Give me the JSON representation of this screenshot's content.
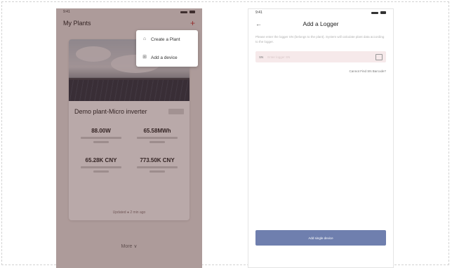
{
  "phone1": {
    "status_time": "9:41",
    "nav_title": "My Plants",
    "nav_action": "+",
    "plant": {
      "name": "Demo plant-Micro inverter",
      "stats": [
        {
          "value": "88.00W"
        },
        {
          "value": "65.58MWh"
        },
        {
          "value": "65.28K CNY"
        },
        {
          "value": "773.50K CNY"
        }
      ],
      "footer": "Updated ● 2 min ago"
    },
    "more": "More ∨"
  },
  "popup": {
    "items": [
      {
        "icon": "create-plant-icon",
        "label": "Create a Plant"
      },
      {
        "icon": "add-device-icon",
        "label": "Add a device"
      }
    ]
  },
  "phone2": {
    "status_time": "9:41",
    "back": "←",
    "nav_title": "Add a Logger",
    "instructions": "Please enter the logger SN (belongs to the plant). System will calculate plant data according to the logger.",
    "input": {
      "prefix": "SN",
      "placeholder": "Enter logger SN"
    },
    "cant_find": "Cannot Find SN Barcode?",
    "add_button": "Add single device"
  },
  "colors": {
    "accent_red": "#c03030",
    "button_blue": "#6f7fae",
    "input_bg": "#f6e9ea"
  }
}
